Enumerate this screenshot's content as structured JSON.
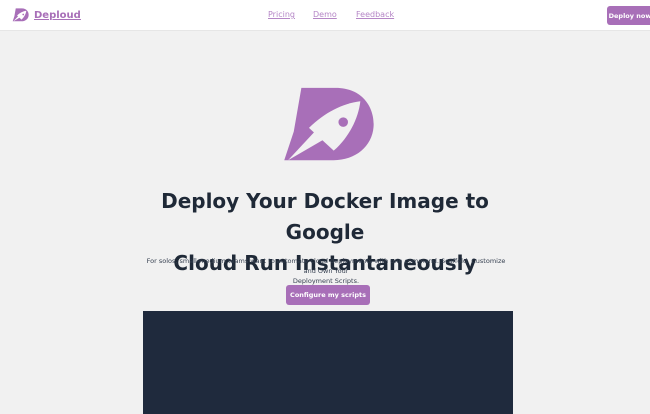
{
  "nav": {
    "brand": "Depl​oud",
    "links": [
      "Pricing",
      "Demo",
      "Feedback"
    ],
    "deploy_label": "Deploy now"
  },
  "hero": {
    "title_line1": "Deploy Your Docker Image to Google",
    "title_line2": "Cloud Run Instantaneously",
    "subtitle_line1": "For solos, small-medium teams want to automate cloud deployments with one command. Scaffold, Customize and Own Your",
    "subtitle_line2": "Deployment Scripts.",
    "cta_label": "Configure my scripts"
  },
  "colors": {
    "accent": "#a86fb8",
    "background": "#f1f1f1",
    "dark_panel": "#1f2a3d",
    "heading": "#1f2937"
  },
  "icons": {
    "brand": "rocket-d-logo-icon",
    "hero": "rocket-d-logo-icon"
  }
}
